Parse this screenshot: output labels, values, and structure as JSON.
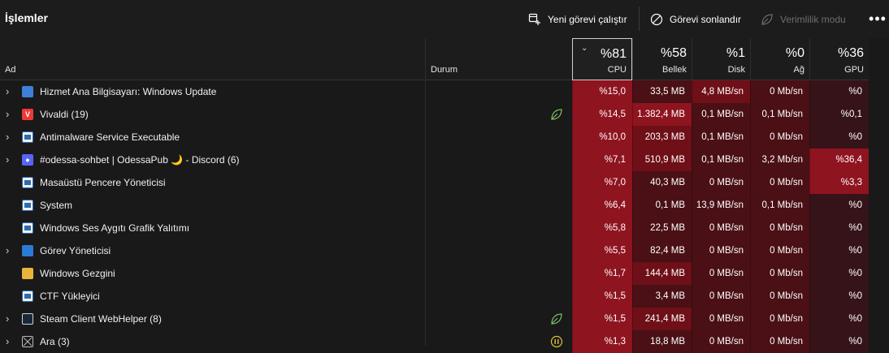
{
  "header": {
    "title": "İşlemler",
    "new_task": "Yeni görevi çalıştır",
    "end_task": "Görevi sonlandır",
    "efficiency": "Verimlilik modu"
  },
  "columns": {
    "name": "Ad",
    "status": "Durum",
    "cpu": {
      "pct": "%81",
      "label": "CPU"
    },
    "memory": {
      "pct": "%58",
      "label": "Bellek"
    },
    "disk": {
      "pct": "%1",
      "label": "Disk"
    },
    "network": {
      "pct": "%0",
      "label": "Ağ"
    },
    "gpu": {
      "pct": "%36",
      "label": "GPU"
    }
  },
  "colors": {
    "bg": "#191919",
    "heat_low": "#4a1015",
    "heat_mid": "#6f0f17",
    "heat_high": "#8e1420",
    "heat_none": "#351318"
  },
  "processes": [
    {
      "expandable": true,
      "icon": "gear-icon",
      "name": "Hizmet Ana Bilgisayarı: Windows Update",
      "status_icon": "",
      "cpu": "%15,0",
      "mem": "33,5 MB",
      "disk": "4,8 MB/sn",
      "net": "0 Mb/sn",
      "gpu": "%0",
      "heat": {
        "cpu": "heat_high",
        "mem": "heat_low",
        "disk": "heat_mid",
        "net": "heat_low",
        "gpu": "heat_none"
      }
    },
    {
      "expandable": true,
      "icon": "vivaldi-icon",
      "name": "Vivaldi (19)",
      "status_icon": "leaf-icon",
      "cpu": "%14,5",
      "mem": "1.382,4 MB",
      "disk": "0,1 MB/sn",
      "net": "0,1 Mb/sn",
      "gpu": "%0,1",
      "heat": {
        "cpu": "heat_high",
        "mem": "heat_high",
        "disk": "heat_low",
        "net": "heat_low",
        "gpu": "heat_none"
      }
    },
    {
      "expandable": true,
      "icon": "window-icon",
      "name": "Antimalware Service Executable",
      "status_icon": "",
      "cpu": "%10,0",
      "mem": "203,3 MB",
      "disk": "0,1 MB/sn",
      "net": "0 Mb/sn",
      "gpu": "%0",
      "heat": {
        "cpu": "heat_high",
        "mem": "heat_mid",
        "disk": "heat_low",
        "net": "heat_low",
        "gpu": "heat_none"
      }
    },
    {
      "expandable": true,
      "icon": "discord-icon",
      "name": "#odessa-sohbet | OdessaPub 🌙 - Discord (6)",
      "status_icon": "",
      "cpu": "%7,1",
      "mem": "510,9 MB",
      "disk": "0,1 MB/sn",
      "net": "3,2 Mb/sn",
      "gpu": "%36,4",
      "heat": {
        "cpu": "heat_high",
        "mem": "heat_mid",
        "disk": "heat_low",
        "net": "heat_low",
        "gpu": "heat_high"
      }
    },
    {
      "expandable": false,
      "icon": "window-icon",
      "name": "Masaüstü Pencere Yöneticisi",
      "status_icon": "",
      "cpu": "%7,0",
      "mem": "40,3 MB",
      "disk": "0 MB/sn",
      "net": "0 Mb/sn",
      "gpu": "%3,3",
      "heat": {
        "cpu": "heat_high",
        "mem": "heat_low",
        "disk": "heat_low",
        "net": "heat_low",
        "gpu": "heat_high"
      }
    },
    {
      "expandable": false,
      "icon": "window-icon",
      "name": "System",
      "status_icon": "",
      "cpu": "%6,4",
      "mem": "0,1 MB",
      "disk": "13,9 MB/sn",
      "net": "0,1 Mb/sn",
      "gpu": "%0",
      "heat": {
        "cpu": "heat_high",
        "mem": "heat_low",
        "disk": "heat_low",
        "net": "heat_low",
        "gpu": "heat_none"
      }
    },
    {
      "expandable": false,
      "icon": "window-icon",
      "name": "Windows Ses Aygıtı Grafik Yalıtımı",
      "status_icon": "",
      "cpu": "%5,8",
      "mem": "22,5 MB",
      "disk": "0 MB/sn",
      "net": "0 Mb/sn",
      "gpu": "%0",
      "heat": {
        "cpu": "heat_high",
        "mem": "heat_low",
        "disk": "heat_low",
        "net": "heat_low",
        "gpu": "heat_none"
      }
    },
    {
      "expandable": true,
      "icon": "task-manager-icon",
      "name": "Görev Yöneticisi",
      "status_icon": "",
      "cpu": "%5,5",
      "mem": "82,4 MB",
      "disk": "0 MB/sn",
      "net": "0 Mb/sn",
      "gpu": "%0",
      "heat": {
        "cpu": "heat_high",
        "mem": "heat_low",
        "disk": "heat_low",
        "net": "heat_low",
        "gpu": "heat_none"
      }
    },
    {
      "expandable": false,
      "icon": "folder-icon",
      "name": "Windows Gezgini",
      "status_icon": "",
      "cpu": "%1,7",
      "mem": "144,4 MB",
      "disk": "0 MB/sn",
      "net": "0 Mb/sn",
      "gpu": "%0",
      "heat": {
        "cpu": "heat_high",
        "mem": "heat_mid",
        "disk": "heat_low",
        "net": "heat_low",
        "gpu": "heat_none"
      }
    },
    {
      "expandable": false,
      "icon": "window-icon",
      "name": "CTF Yükleyici",
      "status_icon": "",
      "cpu": "%1,5",
      "mem": "3,4 MB",
      "disk": "0 MB/sn",
      "net": "0 Mb/sn",
      "gpu": "%0",
      "heat": {
        "cpu": "heat_high",
        "mem": "heat_low",
        "disk": "heat_low",
        "net": "heat_low",
        "gpu": "heat_none"
      }
    },
    {
      "expandable": true,
      "icon": "steam-icon",
      "name": "Steam Client WebHelper (8)",
      "status_icon": "leaf-icon",
      "cpu": "%1,5",
      "mem": "241,4 MB",
      "disk": "0 MB/sn",
      "net": "0 Mb/sn",
      "gpu": "%0",
      "heat": {
        "cpu": "heat_high",
        "mem": "heat_mid",
        "disk": "heat_low",
        "net": "heat_low",
        "gpu": "heat_none"
      }
    },
    {
      "expandable": true,
      "icon": "search-icon",
      "name": "Ara (3)",
      "status_icon": "pause-icon",
      "cpu": "%1,3",
      "mem": "18,8 MB",
      "disk": "0 MB/sn",
      "net": "0 Mb/sn",
      "gpu": "%0",
      "heat": {
        "cpu": "heat_high",
        "mem": "heat_low",
        "disk": "heat_low",
        "net": "heat_low",
        "gpu": "heat_none"
      }
    }
  ]
}
